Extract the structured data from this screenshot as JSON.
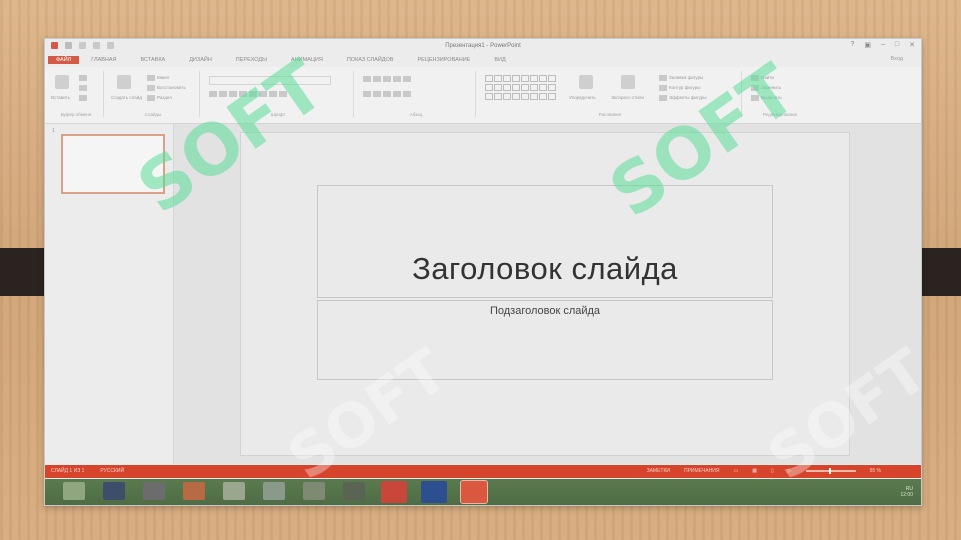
{
  "window": {
    "title": "Презентация1 - PowerPoint"
  },
  "ribbon_tabs": [
    {
      "label": "ФАЙЛ",
      "active": true
    },
    {
      "label": "ГЛАВНАЯ"
    },
    {
      "label": "ВСТАВКА"
    },
    {
      "label": "ДИЗАЙН"
    },
    {
      "label": "ПЕРЕХОДЫ"
    },
    {
      "label": "АНИМАЦИЯ"
    },
    {
      "label": "ПОКАЗ СЛАЙДОВ"
    },
    {
      "label": "РЕЦЕНЗИРОВАНИЕ"
    },
    {
      "label": "ВИД"
    }
  ],
  "sign_in": "Вход",
  "ribbon": {
    "clipboard": {
      "paste": "Вставить",
      "label": "Буфер обмена"
    },
    "slides": {
      "new_slide": "Создать слайд",
      "layout": "Макет",
      "reset": "Восстановить",
      "section": "Раздел",
      "label": "Слайды"
    },
    "font": {
      "label": "Шрифт"
    },
    "paragraph": {
      "label": "Абзац"
    },
    "drawing": {
      "arrange": "Упорядочить",
      "quick_styles": "Экспресс-стили",
      "fill": "Заливка фигуры",
      "outline": "Контур фигуры",
      "effects": "Эффекты фигуры",
      "label": "Рисование"
    },
    "editing": {
      "find": "Найти",
      "replace": "Заменить",
      "select": "Выделить",
      "label": "Редактирование"
    }
  },
  "thumbnail": {
    "number": "1"
  },
  "slide": {
    "title": "Заголовок слайда",
    "subtitle": "Подзаголовок слайда"
  },
  "status": {
    "slide_info": "СЛАЙД 1 ИЗ 1",
    "language": "РУССКИЙ",
    "notes": "ЗАМЕТКИ",
    "comments": "ПРИМЕЧАНИЯ",
    "zoom": "55 %"
  },
  "tray": {
    "time": "12:00",
    "lang": "RU"
  },
  "watermark": {
    "text": "SOFT"
  },
  "colors": {
    "accent": "#d55a46",
    "status_bar": "#d6442c",
    "taskbar": "#54734a"
  }
}
